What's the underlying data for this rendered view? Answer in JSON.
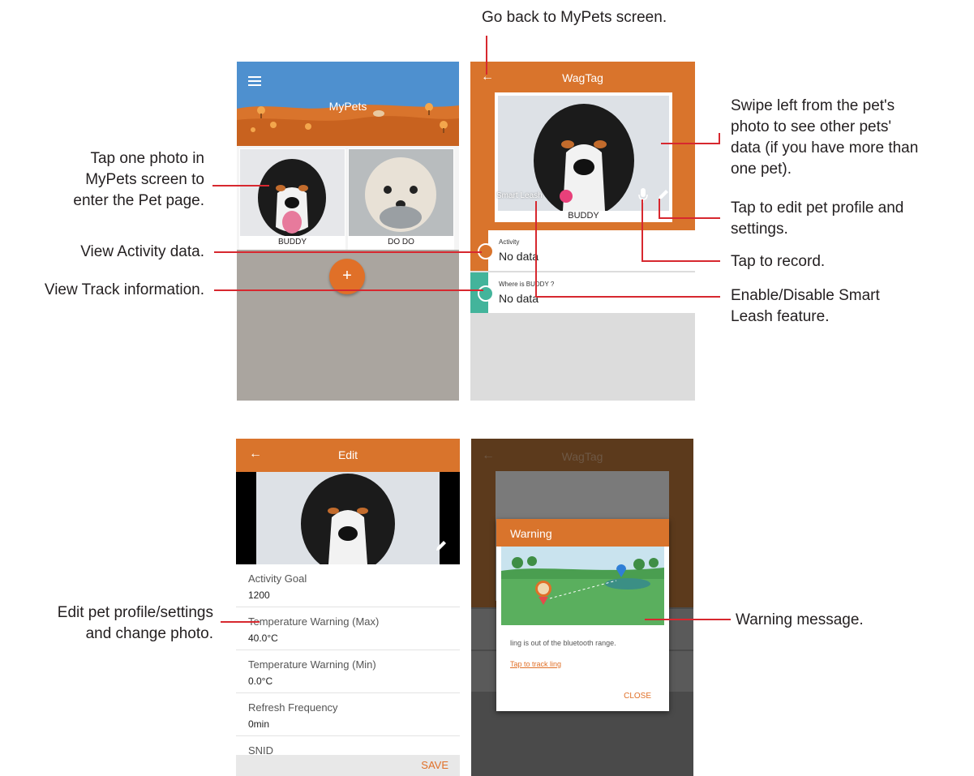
{
  "annotations": {
    "go_back": "Go back to MyPets screen.",
    "tap_photo": [
      "Tap one photo in",
      "MyPets screen to",
      "enter the Pet page."
    ],
    "view_activity": "View Activity data.",
    "view_track": "View Track information.",
    "swipe": [
      "Swipe left from the pet's",
      "photo to see other pets'",
      "data (if you have more than",
      "one pet)."
    ],
    "tap_edit": [
      "Tap to edit pet profile and",
      "settings."
    ],
    "tap_record": "Tap to record.",
    "smart_leash": [
      "Enable/Disable Smart",
      "Leash feature."
    ],
    "edit_profile": [
      "Edit pet profile/settings",
      "and change photo."
    ],
    "warning_msg": "Warning message."
  },
  "mypets": {
    "title": "MyPets",
    "pets": [
      "BUDDY",
      "DO DO"
    ],
    "fab": "+"
  },
  "wagtag": {
    "title": "WagTag",
    "back": "←",
    "pet_name": "BUDDY",
    "smart_leash_label": "Smart Leash",
    "activity_label": "Activity",
    "activity_value": "No data",
    "where_label": "Where is BUDDY ?",
    "where_value": "No data"
  },
  "edit": {
    "title": "Edit",
    "back": "←",
    "fields": [
      {
        "label": "Activity Goal",
        "value": "1200"
      },
      {
        "label": "Temperature Warning (Max)",
        "value": "40.0°C"
      },
      {
        "label": "Temperature Warning (Min)",
        "value": "0.0°C"
      },
      {
        "label": "Refresh Frequency",
        "value": "0min"
      },
      {
        "label": "SNID",
        "value": ""
      }
    ],
    "save": "SAVE"
  },
  "warning": {
    "bg_title": "WagTag",
    "back": "←",
    "title": "Warning",
    "message": "ling is out of the bluetooth range.",
    "link": "Tap to track ling",
    "close": "CLOSE"
  },
  "colors": {
    "accent": "#d9742c",
    "fab": "#e07028",
    "mypets_header": "#4e90cf",
    "track_strip": "#43b49b",
    "leash_toggle": "#e8407a",
    "annotation_line": "#d7282f"
  }
}
